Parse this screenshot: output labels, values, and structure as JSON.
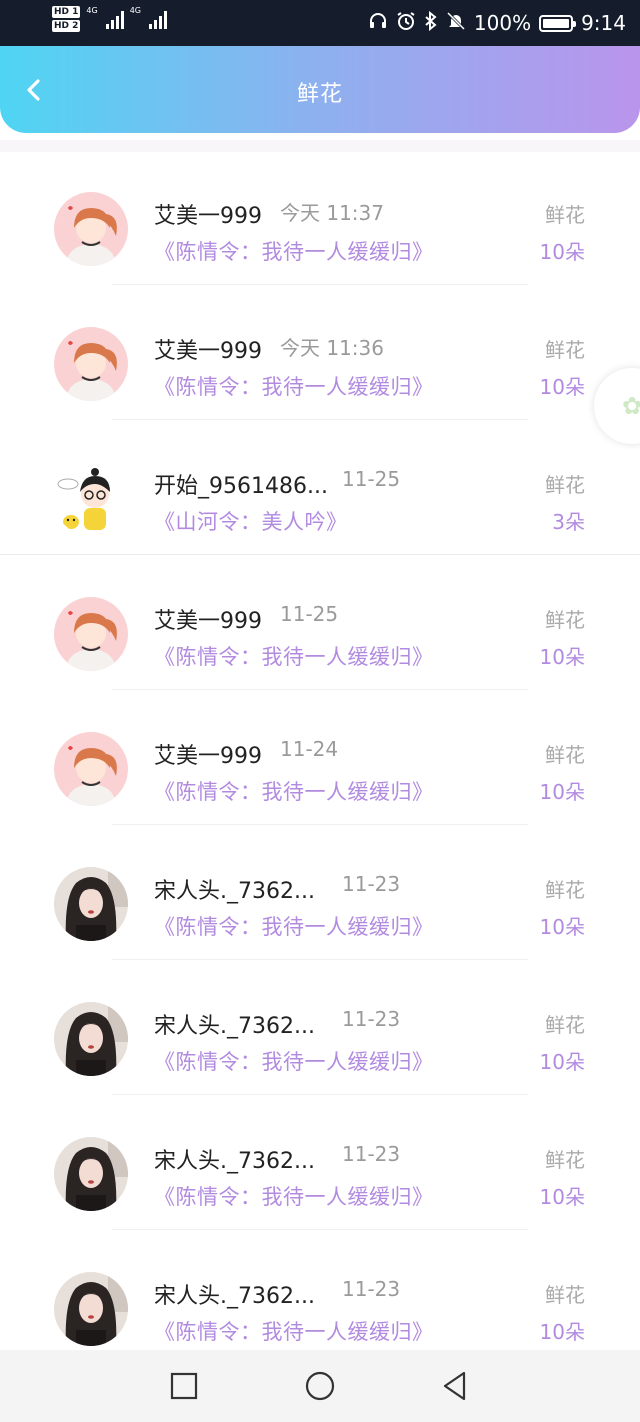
{
  "status_bar": {
    "hd1": "HD 1",
    "hd2": "HD 2",
    "net1": "4G",
    "net2": "4G",
    "battery_text": "100%",
    "battery_level": 1.0,
    "time": "9:14",
    "icons": [
      "headphones-icon",
      "alarm-icon",
      "bluetooth-icon",
      "mute-bell-icon",
      "battery-charging-icon"
    ]
  },
  "header": {
    "title": "鲜花",
    "back_icon": "chevron-left-icon",
    "gradient": [
      "#4fd5f3",
      "#b995ec"
    ]
  },
  "colors": {
    "accent_purple": "#b28be0",
    "muted_gray": "#aaaaaa",
    "name_text": "#222222"
  },
  "items": [
    {
      "name": "艾美一999",
      "time": "今天 11:37",
      "work": "《陈情令：我待一人缓缓归》",
      "gift": "鲜花",
      "count": "10朵",
      "avatar": "avatar-girl-cartoon"
    },
    {
      "name": "艾美一999",
      "time": "今天 11:36",
      "work": "《陈情令：我待一人缓缓归》",
      "gift": "鲜花",
      "count": "10朵",
      "avatar": "avatar-girl-cartoon"
    },
    {
      "name": "开始_9561486...",
      "time": "11-25",
      "work": "《山河令：美人吟》",
      "gift": "鲜花",
      "count": "3朵",
      "avatar": "avatar-boy-cartoon"
    },
    {
      "name": "艾美一999",
      "time": "11-25",
      "work": "《陈情令：我待一人缓缓归》",
      "gift": "鲜花",
      "count": "10朵",
      "avatar": "avatar-girl-cartoon"
    },
    {
      "name": "艾美一999",
      "time": "11-24",
      "work": "《陈情令：我待一人缓缓归》",
      "gift": "鲜花",
      "count": "10朵",
      "avatar": "avatar-girl-cartoon"
    },
    {
      "name": "宋人头._7362...",
      "time": "11-23",
      "work": "《陈情令：我待一人缓缓归》",
      "gift": "鲜花",
      "count": "10朵",
      "avatar": "avatar-photo-woman"
    },
    {
      "name": "宋人头._7362...",
      "time": "11-23",
      "work": "《陈情令：我待一人缓缓归》",
      "gift": "鲜花",
      "count": "10朵",
      "avatar": "avatar-photo-woman"
    },
    {
      "name": "宋人头._7362...",
      "time": "11-23",
      "work": "《陈情令：我待一人缓缓归》",
      "gift": "鲜花",
      "count": "10朵",
      "avatar": "avatar-photo-woman"
    },
    {
      "name": "宋人头._7362...",
      "time": "11-23",
      "work": "《陈情令：我待一人缓缓归》",
      "gift": "鲜花",
      "count": "10朵",
      "avatar": "avatar-photo-woman"
    }
  ],
  "nav_bar": {
    "buttons": [
      "recent-apps-square-icon",
      "home-circle-icon",
      "back-triangle-icon"
    ]
  }
}
